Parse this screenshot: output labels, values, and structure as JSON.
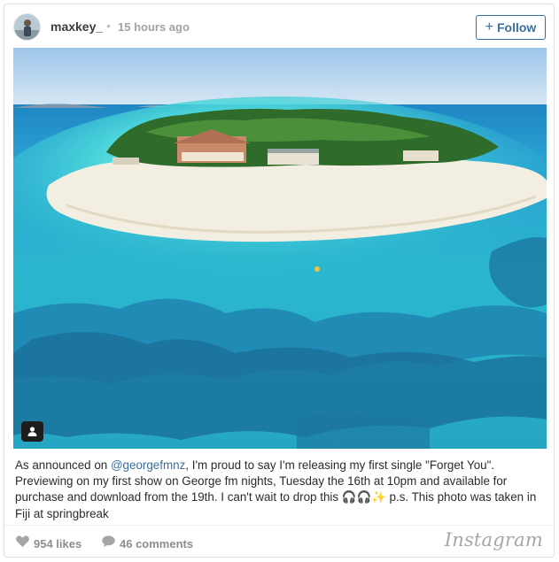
{
  "post": {
    "username": "maxkey_",
    "separator": "•",
    "timestamp": "15 hours ago",
    "follow_label": "Follow",
    "follow_icon": "plus-icon"
  },
  "photo": {
    "subject": "aerial island photo",
    "user_tag_icon": "user-tag-icon"
  },
  "caption": {
    "prefix": "As announced on ",
    "mention": "@georgefmnz",
    "body": ", I'm proud to say I'm releasing my first single \"Forget You\". Previewing on my first show on George fm nights, Tuesday the 16th at 10pm and available for purchase and download from the 19th. I can't wait to drop this 🎧🎧✨ p.s. This photo was taken in Fiji at springbreak"
  },
  "footer": {
    "likes": "954 likes",
    "comments": "46 comments",
    "brand": "Instagram",
    "like_icon": "heart-icon",
    "comment_icon": "comment-bubble-icon"
  },
  "colors": {
    "link": "#3b6ea0",
    "muted": "#8e8e8e",
    "sea_shallow": "#3fd0d8",
    "sea_deep": "#1a6f9a"
  }
}
